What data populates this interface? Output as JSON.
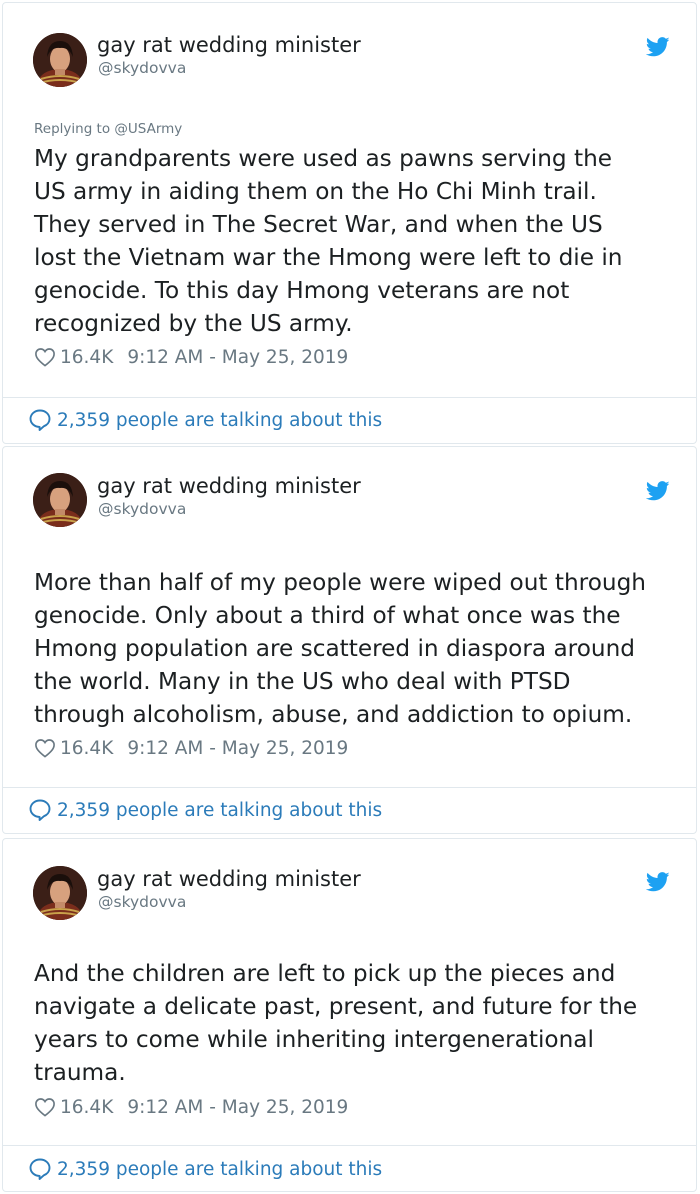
{
  "colors": {
    "text": "#1c2022",
    "muted": "#697882",
    "link": "#2b7bb9",
    "twitter_blue": "#1da1f2",
    "border": "#e1e8ed"
  },
  "tweets": [
    {
      "author": {
        "name": "gay rat wedding minister",
        "handle": "@skydovva",
        "avatar_icon": "profile-photo"
      },
      "reply_prefix": "Replying to ",
      "reply_to": "@USArmy",
      "lines": [
        "My grandparents were used as pawns serving the",
        "US army in aiding them on the Ho Chi Minh trail.",
        "They served in The Secret War, and when the US",
        "lost the Vietnam war the Hmong were left to die in",
        "genocide. To this day Hmong veterans are not",
        "recognized by the US army."
      ],
      "likes": "16.4K",
      "timestamp": "9:12 AM - May 25, 2019",
      "talking": "2,359 people are talking about this"
    },
    {
      "author": {
        "name": "gay rat wedding minister",
        "handle": "@skydovva",
        "avatar_icon": "profile-photo"
      },
      "lines": [
        "More than half of my people were wiped out through",
        "genocide. Only about a third of what once was the",
        "Hmong population are scattered in diaspora around",
        "the world. Many in the US who deal with PTSD",
        "through alcoholism, abuse, and addiction to opium."
      ],
      "likes": "16.4K",
      "timestamp": "9:12 AM - May 25, 2019",
      "talking": "2,359 people are talking about this"
    },
    {
      "author": {
        "name": "gay rat wedding minister",
        "handle": "@skydovva",
        "avatar_icon": "profile-photo"
      },
      "lines": [
        "And the children are left to pick up the pieces and",
        "navigate a delicate past, present, and future for the",
        "years to come while inheriting intergenerational",
        "trauma."
      ],
      "likes": "16.4K",
      "timestamp": "9:12 AM - May 25, 2019",
      "talking": "2,359 people are talking about this"
    }
  ]
}
